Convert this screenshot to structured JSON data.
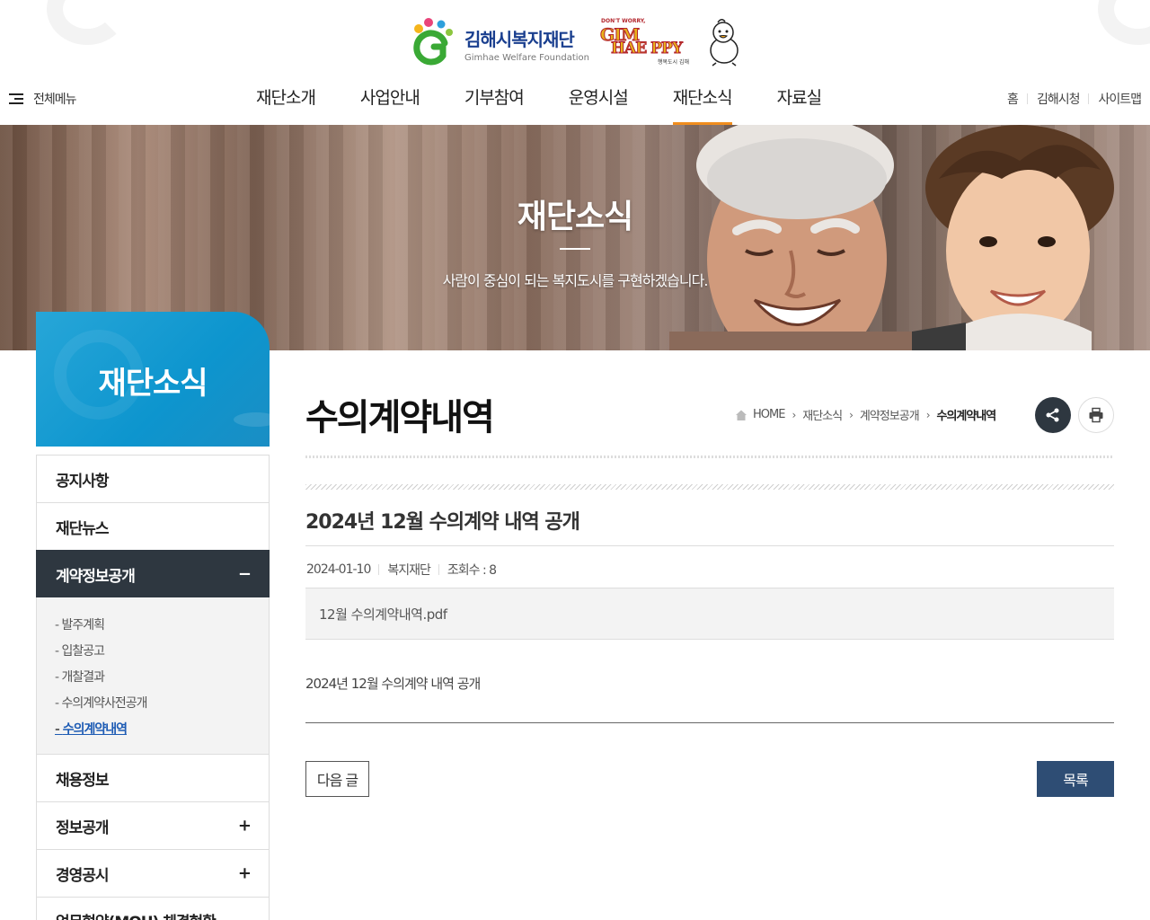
{
  "header": {
    "logo_ko": "김해시복지재단",
    "logo_en": "Gimhae Welfare Foundation",
    "slogan_small": "DON'T WORRY,",
    "slogan_gim": "GIM",
    "slogan_hae": "HAE PPY",
    "slogan_tag": "행복도시 김해",
    "allmenu_label": "전체메뉴",
    "gnb": [
      "재단소개",
      "사업안내",
      "기부참여",
      "운영시설",
      "재단소식",
      "자료실"
    ],
    "gnb_active": "재단소식",
    "util": [
      "홈",
      "김해시청",
      "사이트맵"
    ]
  },
  "visual": {
    "title": "재단소식",
    "subtitle": "사람이 중심이 되는 복지도시를 구현하겠습니다."
  },
  "lnb": {
    "title": "재단소식",
    "items": [
      {
        "label": "공지사항"
      },
      {
        "label": "재단뉴스"
      },
      {
        "label": "계약정보공개",
        "toggle": "−"
      },
      {
        "label": "채용정보"
      },
      {
        "label": "정보공개",
        "toggle": "+"
      },
      {
        "label": "경영공시",
        "toggle": "+"
      },
      {
        "label": "업무협약(MOU) 체결현황"
      }
    ],
    "sub_items": [
      "발주계획",
      "입찰공고",
      "개찰결과",
      "수의계약사전공개",
      "수의계약내역"
    ],
    "sub_current": "수의계약내역"
  },
  "content": {
    "page_title": "수의계약내역",
    "breadcrumb": [
      "HOME",
      "재단소식",
      "계약정보공개",
      "수의계약내역"
    ],
    "post": {
      "title": "2024년 12월 수의계약 내역 공개",
      "date": "2024-01-10",
      "author": "복지재단",
      "views": "조회수 : 8",
      "attachment": "12월 수의계약내역.pdf",
      "body": "2024년 12월 수의계약 내역 공개"
    },
    "buttons": {
      "next": "다음 글",
      "list": "목록"
    }
  },
  "colors": {
    "accent_orange": "#f08d1e",
    "lnb_blue": "#0d95ce",
    "dark_navy": "#2e3740",
    "list_button": "#2e4d74",
    "current_link": "#1d5bb4"
  }
}
